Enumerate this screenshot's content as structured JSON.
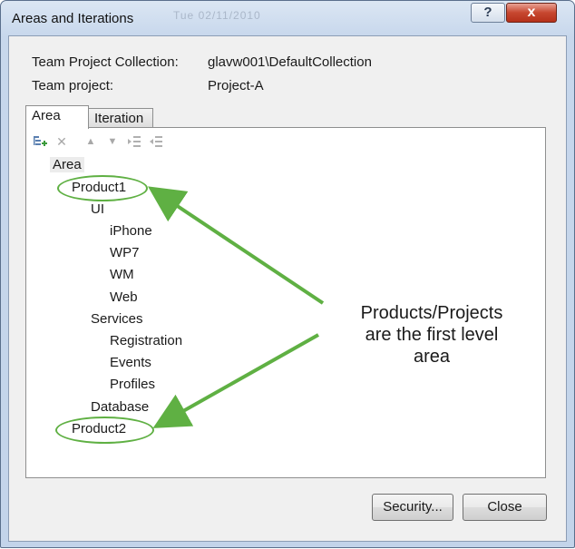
{
  "window": {
    "title": "Areas and Iterations",
    "title_ghost": "Tue    02/11/2010"
  },
  "titlebar_buttons": {
    "help": "?",
    "close": "x"
  },
  "info": {
    "collection_label": "Team Project Collection:",
    "collection_value": "glavw001\\DefaultCollection",
    "project_label": "Team project:",
    "project_value": "Project-A"
  },
  "tabs": [
    {
      "label": "Area",
      "selected": true
    },
    {
      "label": "Iteration",
      "selected": false
    }
  ],
  "toolbar": {
    "icons": [
      "add-node-icon",
      "delete-icon",
      "move-up-icon",
      "move-down-icon",
      "indent-icon",
      "outdent-icon"
    ]
  },
  "tree": {
    "root": "Area",
    "nodes": [
      {
        "label": "Product1",
        "level": 1
      },
      {
        "label": "UI",
        "level": 2
      },
      {
        "label": "iPhone",
        "level": 3
      },
      {
        "label": "WP7",
        "level": 3
      },
      {
        "label": "WM",
        "level": 3
      },
      {
        "label": "Web",
        "level": 3
      },
      {
        "label": "Services",
        "level": 2
      },
      {
        "label": "Registration",
        "level": 3
      },
      {
        "label": "Events",
        "level": 3
      },
      {
        "label": "Profiles",
        "level": 3
      },
      {
        "label": "Database",
        "level": 2
      },
      {
        "label": "Product2",
        "level": 1
      }
    ]
  },
  "annotation": {
    "line1": "Products/Projects",
    "line2": "are the first level",
    "line3": "area",
    "color": "#5fb043"
  },
  "buttons": {
    "security": "Security...",
    "close": "Close"
  }
}
